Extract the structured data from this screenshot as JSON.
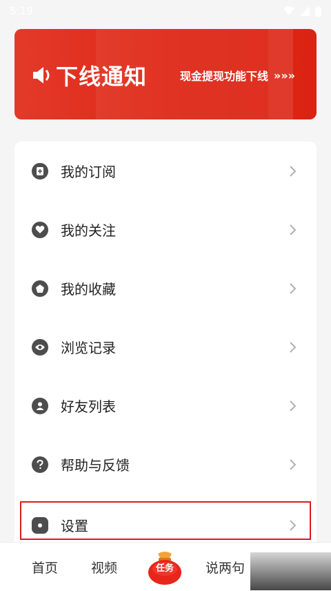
{
  "status": {
    "time": "5:19"
  },
  "banner": {
    "title": "下线通知",
    "subtitle": "现金提现功能下线",
    "arrows": "»»»"
  },
  "menu": {
    "items": [
      {
        "label": "我的订阅",
        "icon": "subscription-icon"
      },
      {
        "label": "我的关注",
        "icon": "heart-icon"
      },
      {
        "label": "我的收藏",
        "icon": "collection-icon"
      },
      {
        "label": "浏览记录",
        "icon": "eye-icon"
      },
      {
        "label": "好友列表",
        "icon": "user-icon"
      },
      {
        "label": "帮助与反馈",
        "icon": "question-icon"
      },
      {
        "label": "设置",
        "icon": "settings-icon"
      }
    ]
  },
  "tabs": [
    {
      "label": "首页"
    },
    {
      "label": "视频"
    },
    {
      "label": "任务"
    },
    {
      "label": "说两句"
    }
  ],
  "colors": {
    "accent": "#e02716",
    "highlight": "#e0191b"
  }
}
